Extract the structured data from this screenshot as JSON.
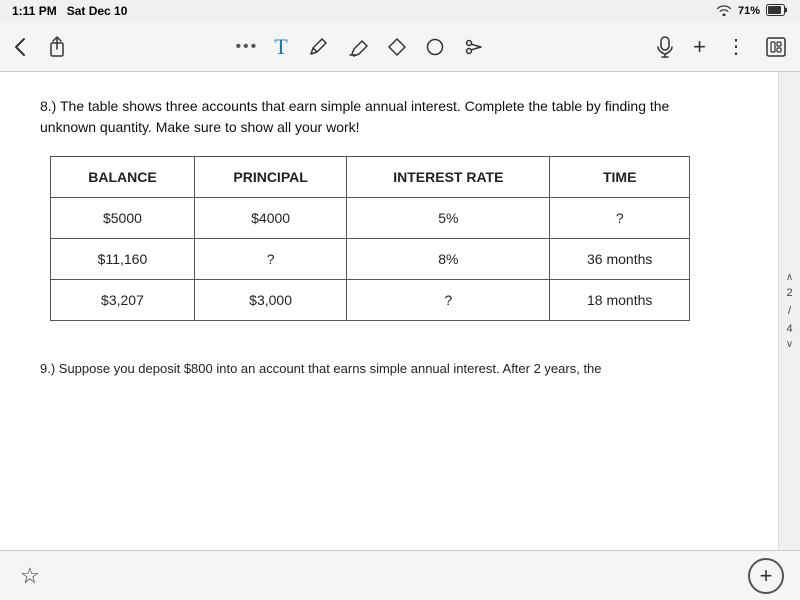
{
  "status_bar": {
    "time": "1:11 PM",
    "date": "Sat Dec 10",
    "wifi": "WiFi",
    "battery": "71%"
  },
  "toolbar": {
    "dots": "•••",
    "back_label": "‹",
    "share_label": "↑",
    "undo_label": "↩",
    "text_tool": "T",
    "pen_tool": "✏",
    "highlighter_tool": "✏",
    "eraser_tool": "◇",
    "shape_tool": "○",
    "scissors_tool": "✂",
    "mic_label": "🎙",
    "plus_label": "+",
    "more_label": "⋮",
    "layout_label": "⊞"
  },
  "page": {
    "question_number": "8.)",
    "question_text": "8.) The table shows three accounts that earn simple annual interest.  Complete the table by finding the unknown quantity.  Make sure to show all your work!",
    "table": {
      "headers": [
        "BALANCE",
        "PRINCIPAL",
        "INTEREST RATE",
        "TIME"
      ],
      "rows": [
        [
          "$5000",
          "$4000",
          "5%",
          "?"
        ],
        [
          "$11,160",
          "?",
          "8%",
          "36 months"
        ],
        [
          "$3,207",
          "$3,000",
          "?",
          "18 months"
        ]
      ]
    },
    "question9_partial": "9.) Suppose you deposit $800 into an account that earns simple annual interest. After 2 years, the"
  },
  "sidebar": {
    "scroll_up": "∧",
    "page_num": "2",
    "slash": "/",
    "page_total": "4",
    "scroll_down": "∨"
  },
  "bottom_bar": {
    "star_icon": "☆",
    "plus_icon": "+"
  }
}
